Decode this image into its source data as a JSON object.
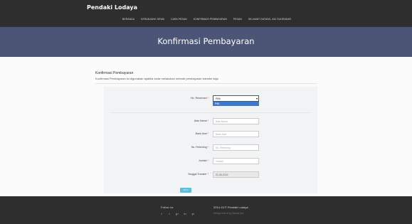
{
  "brand": "Pendaki Lodaya",
  "nav": [
    "BERANDA",
    "KERANJANG SEWA",
    "CARA PESAN",
    "KONFIRMASI PEMBAYARAN",
    "PESAN",
    "SELAMAT DATANG, ADI SUHENDAR"
  ],
  "hero_title": "Konfirmasi Pembayaran",
  "section": {
    "title": "Konfirmasi Pembayaran",
    "description": "Konfirmasi Pembayaran ini digunakan apabila anda melakukan metode pembayaran transfer saja"
  },
  "form": {
    "reservasi": {
      "label": "No. Reservasi",
      "value": "Pilih",
      "option_highlighted": "Pilih"
    },
    "atas_nama": {
      "label": "Atas Nama",
      "placeholder": "Atas Nama"
    },
    "bank_asal": {
      "label": "Bank Asal",
      "placeholder": "Bank Asal"
    },
    "rekening": {
      "label": "No. Rekening",
      "placeholder": "No. Rekening"
    },
    "jumlah": {
      "label": "Jumlah",
      "placeholder": "Jumlah"
    },
    "tanggal": {
      "label": "Tanggal Transfer",
      "value": "01-06-2015"
    },
    "required_mark": "*",
    "submit_label": "Kirim"
  },
  "footer": {
    "follow": "Follow Us",
    "socials": [
      "f",
      "t",
      "g+",
      "in",
      "yt"
    ],
    "copyright": "2014-15 © Pendaki Lodaya",
    "made_with_prefix": "Design with",
    "made_with_heart": "♥",
    "made_with_suffix": " by Daniye Ark"
  },
  "colors": {
    "topbar": "#2e2e2e",
    "hero": "#4b5576",
    "submit": "#5bc0de",
    "highlight": "#3a78d6"
  }
}
